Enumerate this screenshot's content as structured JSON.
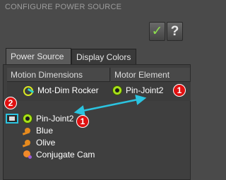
{
  "window": {
    "title": "CONFIGURE POWER SOURCE"
  },
  "toolbar": {
    "ok_label": "✓",
    "help_label": "?"
  },
  "tabs": [
    {
      "label": "Power Source",
      "active": true
    },
    {
      "label": "Display Colors",
      "active": false
    }
  ],
  "table": {
    "headers": [
      "Motion Dimensions",
      "Motor Element"
    ],
    "rows": [
      {
        "motion_dimension": "Mot-Dim Rocker",
        "motor_element": "Pin-Joint2"
      }
    ]
  },
  "tree": {
    "items": [
      {
        "label": "Pin-Joint2",
        "icon": "pin-joint-icon"
      },
      {
        "label": "Blue",
        "icon": "link-icon"
      },
      {
        "label": "Olive",
        "icon": "link-icon"
      },
      {
        "label": "Conjugate Cam",
        "icon": "cam-icon"
      }
    ]
  },
  "callouts": {
    "one": "1",
    "two": "2"
  },
  "colors": {
    "accent_green": "#a8e01a",
    "callout_red": "#e01010",
    "arrow_cyan": "#2bc4e0"
  }
}
